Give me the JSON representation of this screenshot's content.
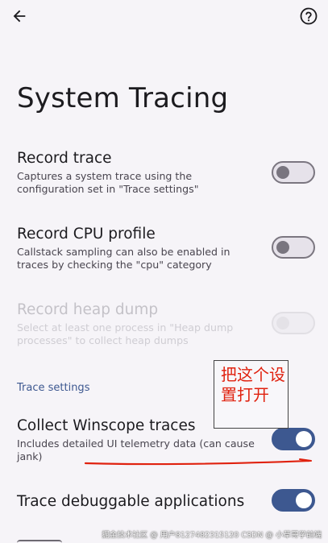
{
  "page": {
    "title": "System Tracing"
  },
  "prefs": {
    "record_trace": {
      "title": "Record trace",
      "summary": "Captures a system trace using the configuration set in \"Trace settings\""
    },
    "record_cpu": {
      "title": "Record CPU profile",
      "summary": "Callstack sampling can also be enabled in traces by checking the \"cpu\" category"
    },
    "record_heap": {
      "title": "Record heap dump",
      "summary": "Select at least one process in \"Heap dump processes\" to collect heap dumps"
    },
    "category_label": "Trace settings",
    "winscope": {
      "title": "Collect Winscope traces",
      "summary": "Includes detailed UI telemetry data (can cause jank)"
    },
    "debuggable": {
      "title": "Trace debuggable applications"
    }
  },
  "annotation": {
    "text": "把这个设置打开",
    "color": "#e0220f"
  },
  "watermark": {
    "text": "掘金技术社区 @ 用户8127482315120  CSDN @ 小草哥学前端"
  },
  "colors": {
    "accent": "#3d5890",
    "background": "#f6f4f8"
  },
  "icons": {
    "back": "arrow-left",
    "help": "question-circle"
  }
}
